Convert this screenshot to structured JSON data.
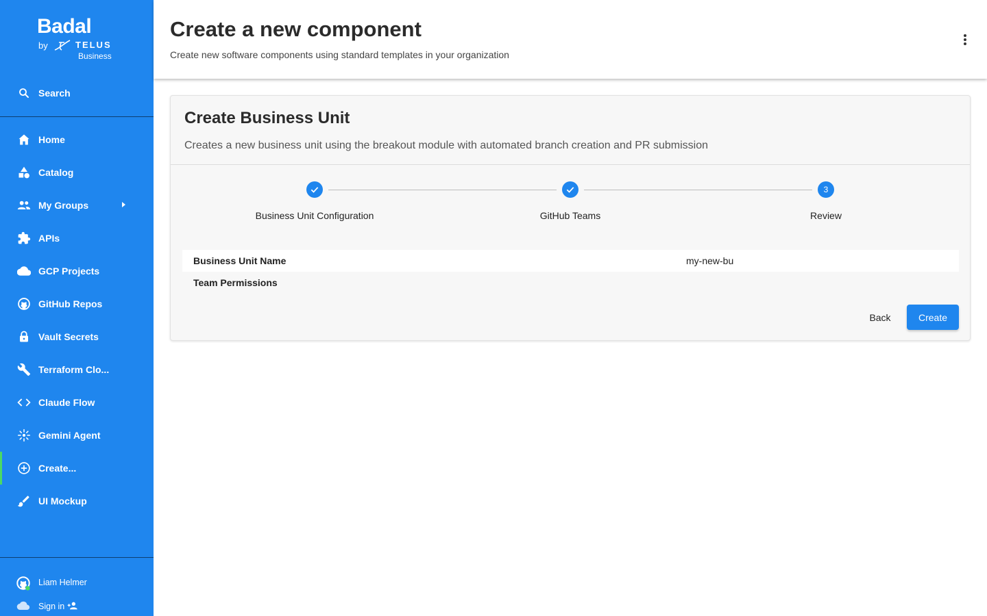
{
  "brand": {
    "name": "Badal",
    "by": "by",
    "partner": "TELUS",
    "partner_sub": "Business"
  },
  "sidebar": {
    "search_label": "Search",
    "items": [
      {
        "label": "Home",
        "icon": "home-icon"
      },
      {
        "label": "Catalog",
        "icon": "catalog-icon"
      },
      {
        "label": "My Groups",
        "icon": "groups-icon"
      },
      {
        "label": "APIs",
        "icon": "puzzle-icon"
      },
      {
        "label": "GCP Projects",
        "icon": "cloud-icon"
      },
      {
        "label": "GitHub Repos",
        "icon": "github-icon"
      },
      {
        "label": "Vault Secrets",
        "icon": "lock-icon"
      },
      {
        "label": "Terraform Clo...",
        "icon": "wrench-icon"
      },
      {
        "label": "Claude Flow",
        "icon": "code-icon"
      },
      {
        "label": "Gemini Agent",
        "icon": "sparkle-icon"
      },
      {
        "label": "Create...",
        "icon": "add-circle-icon"
      },
      {
        "label": "UI Mockup",
        "icon": "brush-icon"
      }
    ],
    "active_item": "Create...",
    "user_name": "Liam Helmer",
    "sign_in_label": "Sign in"
  },
  "header": {
    "title": "Create a new component",
    "subtitle": "Create new software components using standard templates in your organization"
  },
  "card": {
    "title": "Create Business Unit",
    "description": "Creates a new business unit using the breakout module with automated branch creation and PR submission",
    "steps": [
      {
        "label": "Business Unit Configuration",
        "state": "done"
      },
      {
        "label": "GitHub Teams",
        "state": "done"
      },
      {
        "label": "Review",
        "state": "active",
        "number": "3"
      }
    ],
    "review": [
      {
        "key": "Business Unit Name",
        "value": "my-new-bu"
      },
      {
        "key": "Team Permissions",
        "value": ""
      }
    ],
    "back_label": "Back",
    "create_label": "Create"
  },
  "colors": {
    "sidebar": "#1f86ee",
    "accent": "#1f86ee",
    "active_indicator": "#4cd964"
  }
}
